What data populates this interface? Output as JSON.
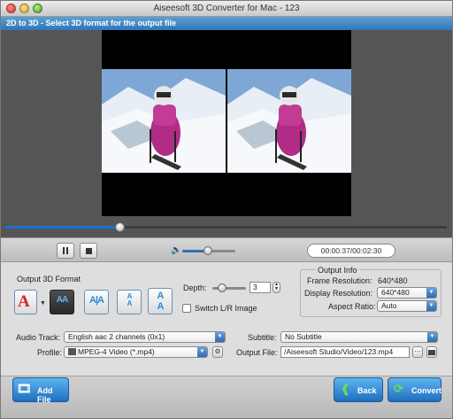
{
  "window": {
    "title": "Aiseesoft 3D Converter for Mac - 123",
    "subtitle": "2D to 3D - Select 3D format for the output file"
  },
  "player": {
    "time_display": "00:00:37/00:02:30",
    "seek_progress": 0.26,
    "volume_level": 0.48,
    "buttons": {
      "pause": "pause-icon",
      "stop": "stop-icon"
    }
  },
  "output_3d_format": {
    "label": "Output 3D Format",
    "options": [
      "Anaglyph",
      "Side by Side (Half-Width)",
      "Side by Side (Full)",
      "Top and Bottom (Half-Height)",
      "Top and Bottom (Full)"
    ],
    "selected_index": 1
  },
  "depth": {
    "label": "Depth:",
    "value": "3",
    "level": 0.3
  },
  "switch_lr": {
    "label": "Switch L/R Image",
    "checked": false
  },
  "output_info": {
    "label": "Output Info",
    "frame_resolution_label": "Frame Resolution:",
    "frame_resolution_value": "640*480",
    "display_resolution_label": "Display Resolution:",
    "display_resolution_value": "640*480",
    "aspect_ratio_label": "Aspect Ratio:",
    "aspect_ratio_value": "Auto"
  },
  "settings": {
    "audio_track_label": "Audio Track:",
    "audio_track_value": "English aac 2 channels (0x1)",
    "profile_label": "Profile:",
    "profile_value": "MPEG-4 Video (*.mp4)",
    "subtitle_label": "Subtitle:",
    "subtitle_value": "No Subtitle",
    "output_file_label": "Output File:",
    "output_file_value": "/Aiseesoft Studio/Video/123.mp4",
    "browse_label": "···"
  },
  "footer": {
    "add_file": "Add File",
    "back": "Back",
    "convert": "Convert"
  },
  "colors": {
    "accent": "#2f76b8",
    "anaglyph_red": "#d12a2a",
    "format_blue": "#2a8adf"
  }
}
